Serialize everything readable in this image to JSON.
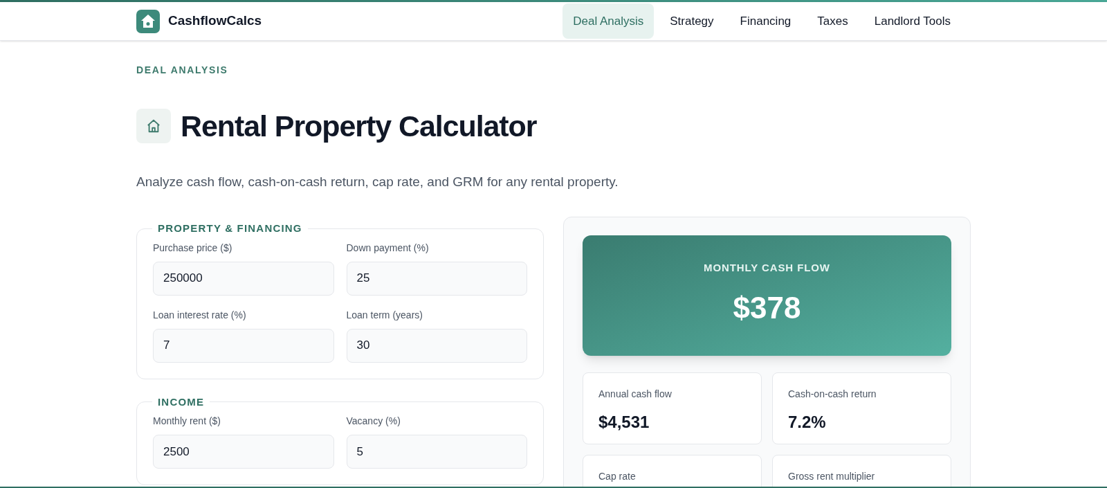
{
  "header": {
    "brand": "CashflowCalcs",
    "nav": [
      {
        "label": "Deal Analysis",
        "selected": true
      },
      {
        "label": "Strategy",
        "selected": false
      },
      {
        "label": "Financing",
        "selected": false
      },
      {
        "label": "Taxes",
        "selected": false
      },
      {
        "label": "Landlord Tools",
        "selected": false
      }
    ]
  },
  "eyebrow": "DEAL ANALYSIS",
  "title": "Rental Property Calculator",
  "description": "Analyze cash flow, cash-on-cash return, cap rate, and GRM for any rental property.",
  "sections": [
    {
      "legend": "PROPERTY & FINANCING",
      "fields": [
        {
          "label": "Purchase price ($)",
          "value": "250000"
        },
        {
          "label": "Down payment (%)",
          "value": "25"
        },
        {
          "label": "Loan interest rate (%)",
          "value": "7"
        },
        {
          "label": "Loan term (years)",
          "value": "30"
        }
      ]
    },
    {
      "legend": "INCOME",
      "fields": [
        {
          "label": "Monthly rent ($)",
          "value": "2500"
        },
        {
          "label": "Vacancy (%)",
          "value": "5"
        }
      ]
    }
  ],
  "results": {
    "hero": {
      "label": "MONTHLY CASH FLOW",
      "value": "$378"
    },
    "stats": [
      {
        "label": "Annual cash flow",
        "value": "$4,531"
      },
      {
        "label": "Cash-on-cash return",
        "value": "7.2%"
      },
      {
        "label": "Cap rate"
      },
      {
        "label": "Gross rent multiplier"
      }
    ]
  }
}
